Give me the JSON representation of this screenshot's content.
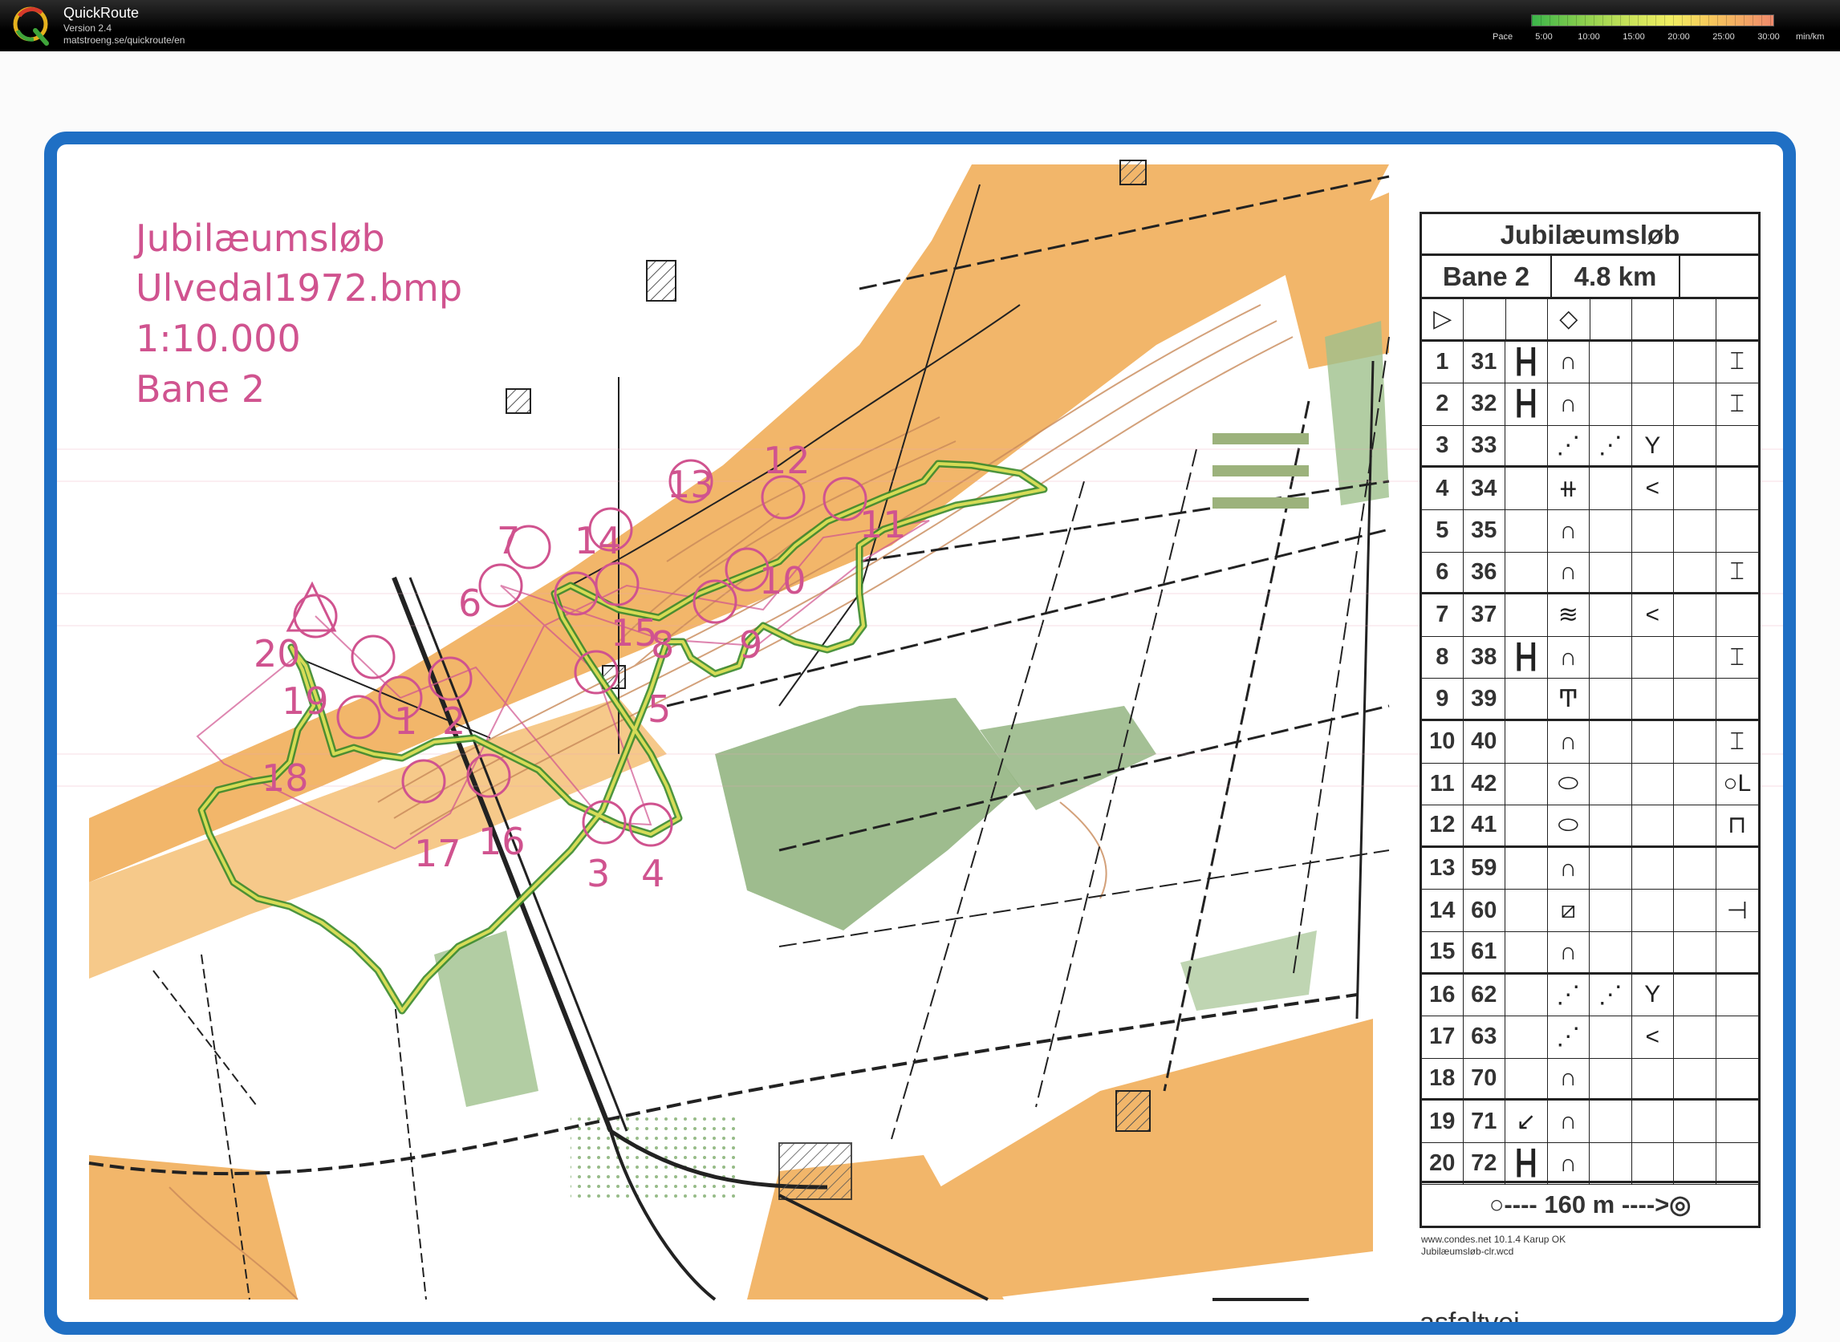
{
  "app": {
    "name": "QuickRoute",
    "version": "Version 2.4",
    "url": "matstroeng.se/quickroute/en",
    "logo_letter": "Q"
  },
  "pace_legend": {
    "label": "Pace",
    "ticks": [
      "5:00",
      "10:00",
      "15:00",
      "20:00",
      "25:00",
      "30:00"
    ],
    "unit": "min/km"
  },
  "map": {
    "title_lines": [
      "Jubilæumsløb",
      "Ulvedal1972.bmp",
      "1:10.000",
      "Bane 2"
    ],
    "colors": {
      "frame": "#1f6fc4",
      "course": "#d0538f",
      "route_green": "#3a8a2a",
      "route_yellow": "#e6e35a",
      "open_land": "#f2b66a",
      "forest_green": "#8db07a"
    },
    "controls": [
      {
        "number": "1"
      },
      {
        "number": "2"
      },
      {
        "number": "3"
      },
      {
        "number": "4"
      },
      {
        "number": "5"
      },
      {
        "number": "6"
      },
      {
        "number": "7"
      },
      {
        "number": "8"
      },
      {
        "number": "9"
      },
      {
        "number": "10"
      },
      {
        "number": "11"
      },
      {
        "number": "12"
      },
      {
        "number": "13"
      },
      {
        "number": "14"
      },
      {
        "number": "15"
      },
      {
        "number": "16"
      },
      {
        "number": "17"
      },
      {
        "number": "18"
      },
      {
        "number": "19"
      },
      {
        "number": "20"
      }
    ],
    "legend_text": "asfaltvej"
  },
  "control_description": {
    "title": "Jubilæumsløb",
    "course": "Bane 2",
    "length": "4.8 km",
    "rows": [
      {
        "num": "1",
        "code": "31",
        "c": "┣┫",
        "d": "∩",
        "e": "",
        "f": "",
        "h": "⌶"
      },
      {
        "num": "2",
        "code": "32",
        "c": "┣┫",
        "d": "∩",
        "e": "",
        "f": "",
        "h": "⌶"
      },
      {
        "num": "3",
        "code": "33",
        "c": "",
        "d": "⋰",
        "e": "⋰",
        "f": "Y",
        "h": ""
      },
      {
        "num": "4",
        "code": "34",
        "c": "",
        "d": "⧺",
        "e": "",
        "f": "<",
        "h": ""
      },
      {
        "num": "5",
        "code": "35",
        "c": "",
        "d": "∩",
        "e": "",
        "f": "",
        "h": ""
      },
      {
        "num": "6",
        "code": "36",
        "c": "",
        "d": "∩",
        "e": "",
        "f": "",
        "h": "⌶"
      },
      {
        "num": "7",
        "code": "37",
        "c": "",
        "d": "≋",
        "e": "",
        "f": "<",
        "h": ""
      },
      {
        "num": "8",
        "code": "38",
        "c": "┣┫",
        "d": "∩",
        "e": "",
        "f": "",
        "h": "⌶"
      },
      {
        "num": "9",
        "code": "39",
        "c": "",
        "d": "Ͳ",
        "e": "",
        "f": "",
        "h": ""
      },
      {
        "num": "10",
        "code": "40",
        "c": "",
        "d": "∩",
        "e": "",
        "f": "",
        "h": "⌶"
      },
      {
        "num": "11",
        "code": "42",
        "c": "",
        "d": "⬭",
        "e": "",
        "f": "",
        "h": "○L"
      },
      {
        "num": "12",
        "code": "41",
        "c": "",
        "d": "⬭",
        "e": "",
        "f": "",
        "h": "⊓"
      },
      {
        "num": "13",
        "code": "59",
        "c": "",
        "d": "∩",
        "e": "",
        "f": "",
        "h": ""
      },
      {
        "num": "14",
        "code": "60",
        "c": "",
        "d": "⧄",
        "e": "",
        "f": "",
        "h": "⊣"
      },
      {
        "num": "15",
        "code": "61",
        "c": "",
        "d": "∩",
        "e": "",
        "f": "",
        "h": ""
      },
      {
        "num": "16",
        "code": "62",
        "c": "",
        "d": "⋰",
        "e": "⋰",
        "f": "Y",
        "h": ""
      },
      {
        "num": "17",
        "code": "63",
        "c": "",
        "d": "⋰",
        "e": "",
        "f": "<",
        "h": ""
      },
      {
        "num": "18",
        "code": "70",
        "c": "",
        "d": "∩",
        "e": "",
        "f": "",
        "h": ""
      },
      {
        "num": "19",
        "code": "71",
        "c": "↙",
        "d": "∩",
        "e": "",
        "f": "",
        "h": ""
      },
      {
        "num": "20",
        "code": "72",
        "c": "┣┫",
        "d": "∩",
        "e": "",
        "f": "",
        "h": ""
      }
    ],
    "start_row": {
      "sym": "▷",
      "d": "◇"
    },
    "finish": "○---- 160 m ---->◎",
    "credit_lines": [
      "www.condes.net 10.1.4 Karup OK",
      "Jubilæumsløb-clr.wcd"
    ]
  }
}
